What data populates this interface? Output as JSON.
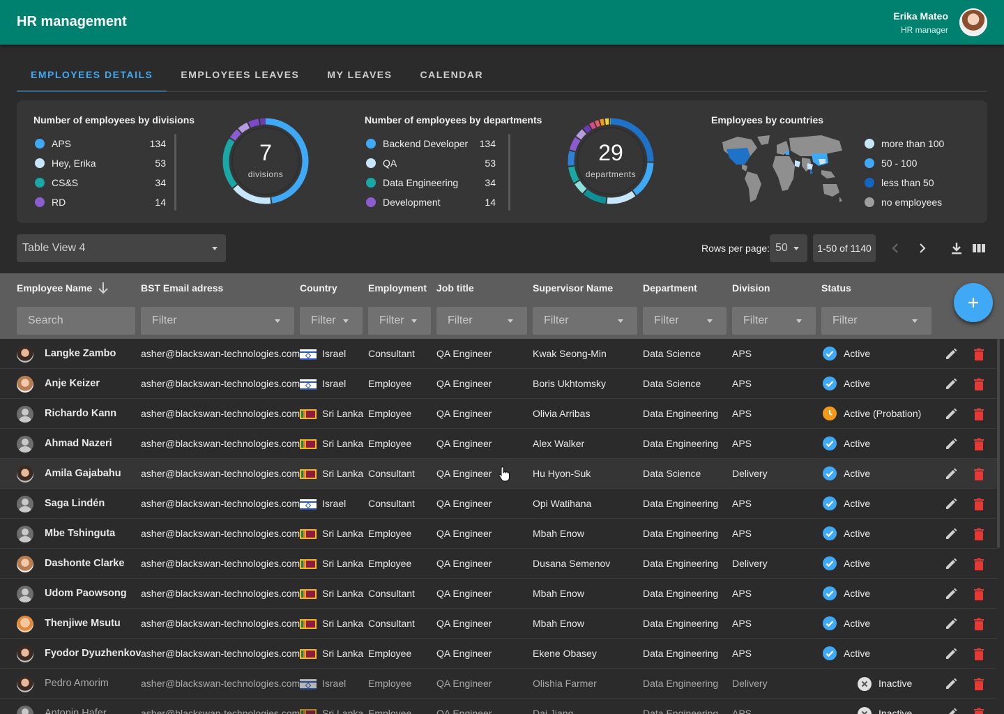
{
  "header": {
    "title": "HR management",
    "user_name": "Erika Mateo",
    "user_role": "HR manager"
  },
  "tabs": [
    "EMPLOYEES DETAILS",
    "EMPLOYEES LEAVES",
    "MY LEAVES",
    "CALENDAR"
  ],
  "stats": {
    "divisions": {
      "title": "Number of employees by divisions",
      "items": [
        {
          "label": "APS",
          "value": "134",
          "color": "#3fa9f5"
        },
        {
          "label": "Hey, Erika",
          "value": "53",
          "color": "#c6e6fb"
        },
        {
          "label": "CS&S",
          "value": "34",
          "color": "#1aa7a5"
        },
        {
          "label": "RD",
          "value": "14",
          "color": "#8c5cd1"
        }
      ],
      "total": "7",
      "total_label": "divisions"
    },
    "departments": {
      "title": "Number of employees by departments",
      "items": [
        {
          "label": "Backend Developer",
          "value": "134",
          "color": "#3fa9f5"
        },
        {
          "label": "QA",
          "value": "53",
          "color": "#c6e6fb"
        },
        {
          "label": "Data Engineering",
          "value": "34",
          "color": "#1aa7a5"
        },
        {
          "label": "Development",
          "value": "14",
          "color": "#8c5cd1"
        }
      ],
      "total": "29",
      "total_label": "departments"
    },
    "countries": {
      "title": "Employees by countries",
      "items": [
        {
          "label": "more than 100",
          "color": "#c6e6fb"
        },
        {
          "label": "50 - 100",
          "color": "#3fa9f5"
        },
        {
          "label": "less than 50",
          "color": "#1565c0"
        },
        {
          "label": "no employees",
          "color": "#9e9e9e"
        }
      ]
    }
  },
  "toolbar": {
    "view": "Table View 4",
    "rows_per_page_label": "Rows per page:",
    "rows_per_page": "50",
    "range": "1-50 of 1140"
  },
  "columns": [
    "Employee Name",
    "BST Email adress",
    "Country",
    "Employment",
    "Job title",
    "Supervisor Name",
    "Department",
    "Division",
    "Status"
  ],
  "filters": {
    "search": "Search",
    "filter": "Filter"
  },
  "rows": [
    {
      "name": "Langke Zambo",
      "email": "asher@blackswan-technologies.com",
      "country": "Israel",
      "employment": "Consultant",
      "job": "QA Engineer",
      "supervisor": "Kwak Seong-Min",
      "department": "Data Science",
      "division": "APS",
      "status": "Active"
    },
    {
      "name": "Anje Keizer",
      "email": "asher@blackswan-technologies.com",
      "country": "Israel",
      "employment": "Employee",
      "job": "QA Engineer",
      "supervisor": "Boris Ukhtomsky",
      "department": "Data Science",
      "division": "APS",
      "status": "Active"
    },
    {
      "name": "Richardo Kann",
      "email": "asher@blackswan-technologies.com",
      "country": "Sri Lanka",
      "employment": "Employee",
      "job": "QA Engineer",
      "supervisor": "Olivia Arribas",
      "department": "Data Engineering",
      "division": "APS",
      "status": "Active (Probation)"
    },
    {
      "name": "Ahmad Nazeri",
      "email": "asher@blackswan-technologies.com",
      "country": "Sri Lanka",
      "employment": "Employee",
      "job": "QA Engineer",
      "supervisor": "Alex Walker",
      "department": "Data Engineering",
      "division": "APS",
      "status": "Active"
    },
    {
      "name": "Amila Gajabahu",
      "email": "asher@blackswan-technologies.com",
      "country": "Sri Lanka",
      "employment": "Consultant",
      "job": "QA Engineer",
      "supervisor": "Hu Hyon-Suk",
      "department": "Data Science",
      "division": "Delivery",
      "status": "Active"
    },
    {
      "name": "Saga Lindén",
      "email": "asher@blackswan-technologies.com",
      "country": "Israel",
      "employment": "Consultant",
      "job": "QA Engineer",
      "supervisor": "Opi Watihana",
      "department": "Data Engineering",
      "division": "APS",
      "status": "Active"
    },
    {
      "name": "Mbe Tshinguta",
      "email": "asher@blackswan-technologies.com",
      "country": "Sri Lanka",
      "employment": "Employee",
      "job": "QA Engineer",
      "supervisor": "Mbah Enow",
      "department": "Data Engineering",
      "division": "APS",
      "status": "Active"
    },
    {
      "name": "Dashonte Clarke",
      "email": "asher@blackswan-technologies.com",
      "country": "Sri Lanka",
      "employment": "Employee",
      "job": "QA Engineer",
      "supervisor": "Dusana Semenov",
      "department": "Data Engineering",
      "division": "Delivery",
      "status": "Active"
    },
    {
      "name": "Udom Paowsong",
      "email": "asher@blackswan-technologies.com",
      "country": "Sri Lanka",
      "employment": "Consultant",
      "job": "QA Engineer",
      "supervisor": "Mbah Enow",
      "department": "Data Engineering",
      "division": "APS",
      "status": "Active"
    },
    {
      "name": "Thenjiwe Msutu",
      "email": "asher@blackswan-technologies.com",
      "country": "Sri Lanka",
      "employment": "Consultant",
      "job": "QA Engineer",
      "supervisor": "Mbah Enow",
      "department": "Data Engineering",
      "division": "APS",
      "status": "Active"
    },
    {
      "name": "Fyodor Dyuzhenkov",
      "email": "asher@blackswan-technologies.com",
      "country": "Sri Lanka",
      "employment": "Employee",
      "job": "QA Engineer",
      "supervisor": "Ekene Obasey",
      "department": "Data Engineering",
      "division": "APS",
      "status": "Active"
    },
    {
      "name": "Pedro Amorim",
      "email": "asher@blackswan-technologies.com",
      "country": "Israel",
      "employment": "Employee",
      "job": "QA Engineer",
      "supervisor": "Olishia Farmer",
      "department": "Data Engineering",
      "division": "Delivery",
      "status": "Inactive"
    },
    {
      "name": "Antonin Hafer",
      "email": "asher@blackswan-technologies.com",
      "country": "Sri Lanka",
      "employment": "Employee",
      "job": "QA Engineer",
      "supervisor": "Dai Jiang",
      "department": "Data Engineering",
      "division": "APS",
      "status": "Inactive"
    }
  ]
}
